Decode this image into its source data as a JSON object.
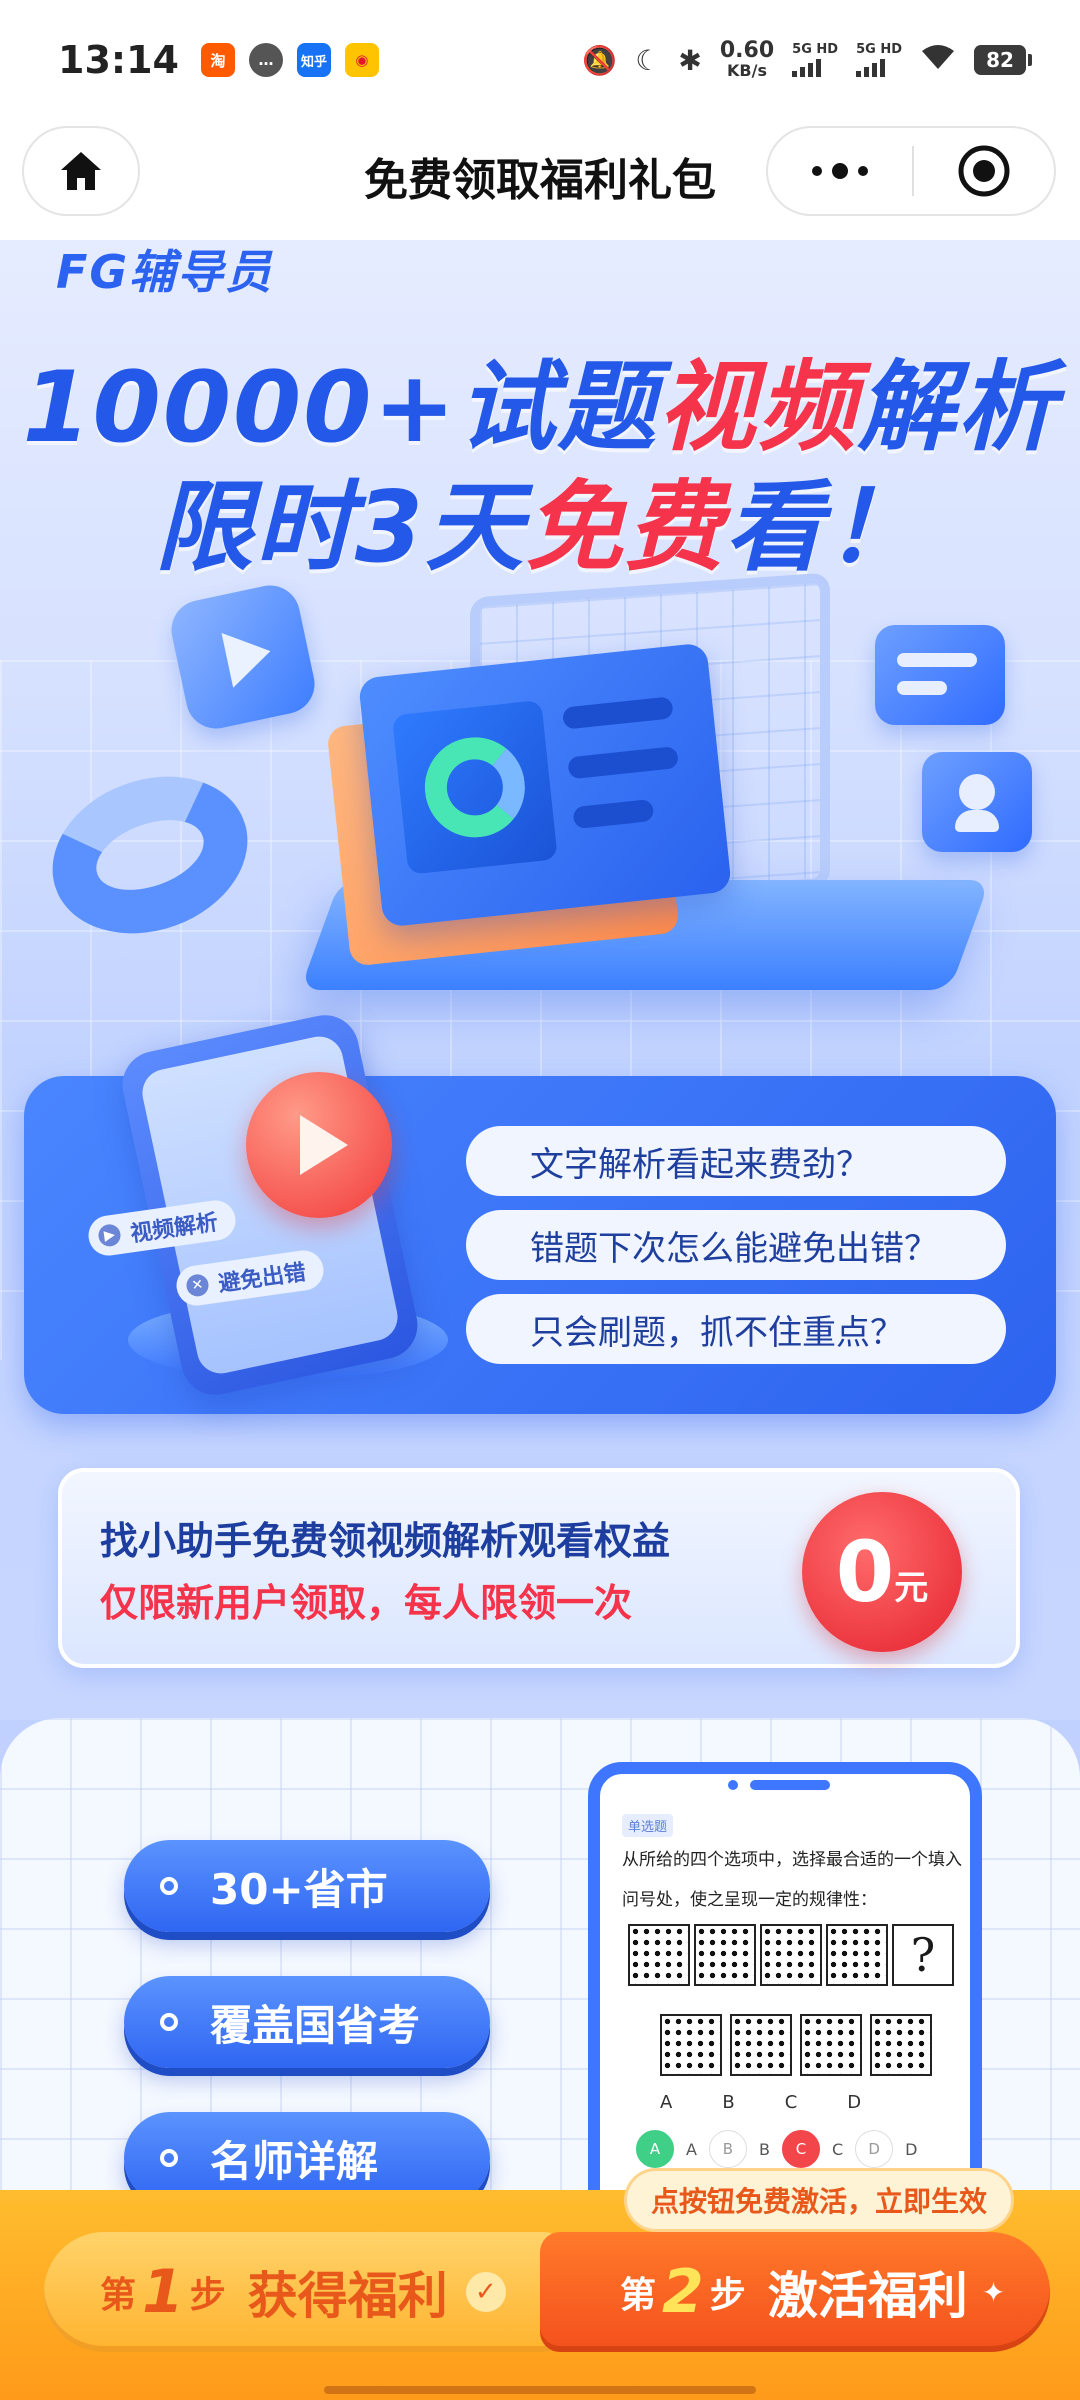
{
  "status_bar": {
    "time": "13:14",
    "app_icons": [
      "taobao-icon",
      "message-icon",
      "zhihu-icon",
      "weibo-icon"
    ],
    "app_icon_text": {
      "taobao": "淘",
      "zhihu": "知乎"
    },
    "net_speed_value": "0.60",
    "net_speed_unit": "KB/s",
    "signal1": "5G HD",
    "signal2": "5G HD",
    "battery": "82"
  },
  "nav": {
    "title": "免费领取福利礼包"
  },
  "hero": {
    "logo": "FG辅导员",
    "line1_a": "10000+试题",
    "line1_b": "视频",
    "line1_c": "解析",
    "line2_a": "限时3天",
    "line2_b": "免费",
    "line2_c": "看！"
  },
  "questions": [
    "文字解析看起来费劲？",
    "错题下次怎么能避免出错？",
    "只会刷题，抓不住重点？"
  ],
  "phone_tags": {
    "tag1": "视频解析",
    "tag2": "避免出错"
  },
  "promo": {
    "line1": "找小助手免费领视频解析观看权益",
    "line2": "仅限新用户领取，每人限领一次",
    "price": "0",
    "price_unit": "元"
  },
  "features": [
    "30+省市",
    "覆盖国省考",
    "名师详解"
  ],
  "sample_question": {
    "type_tag": "单选题",
    "stem": "从所给的四个选项中，选择最合适的一个填入问号处，使之呈现一定的规律性：",
    "question_mark": "?",
    "option_letters": [
      "A",
      "B",
      "C",
      "D"
    ]
  },
  "cta": {
    "bubble": "点按钮免费激活，立即生效",
    "step1_prefix": "第",
    "step1_num": "1",
    "step1_suffix": "步",
    "step1_label": "获得福利",
    "step2_prefix": "第",
    "step2_num": "2",
    "step2_suffix": "步",
    "step2_label": "激活福利"
  },
  "colors": {
    "brand_blue": "#2f66f2",
    "accent_red": "#f5334a",
    "cta_orange": "#f4501c"
  }
}
